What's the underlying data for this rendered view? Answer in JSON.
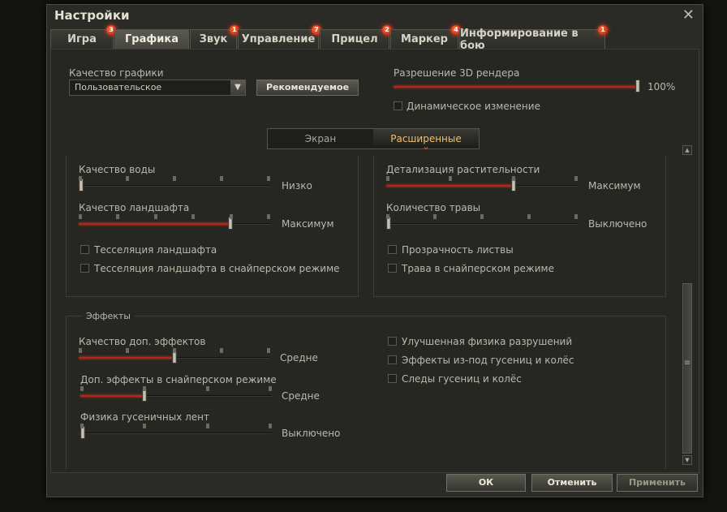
{
  "window": {
    "title": "Настройки"
  },
  "tabs": [
    {
      "label": "Игра",
      "badge": "3"
    },
    {
      "label": "Графика",
      "badge": ""
    },
    {
      "label": "Звук",
      "badge": "1"
    },
    {
      "label": "Управление",
      "badge": "7"
    },
    {
      "label": "Прицел",
      "badge": "2"
    },
    {
      "label": "Маркер",
      "badge": "4"
    },
    {
      "label": "Информирование в бою",
      "badge": "1"
    }
  ],
  "graphics": {
    "quality_label": "Качество графики",
    "quality_value": "Пользовательское",
    "recommended_button": "Рекомендуемое",
    "resolution_label": "Разрешение 3D рендера",
    "resolution_value": "100%",
    "resolution_level": 1.0,
    "dynamic_label": "Динамическое изменение"
  },
  "subtabs": [
    "Экран",
    "Расширенные"
  ],
  "left_panel": {
    "water_label": "Качество воды",
    "water_value": "Низко",
    "water_level": 0,
    "landscape_label": "Качество ландшафта",
    "landscape_value": "Максимум",
    "landscape_level": 0.8,
    "tess_label": "Тесселяция ландшафта",
    "tess_sniper_label": "Тесселяция ландшафта в снайперском режиме"
  },
  "right_panel": {
    "veg_label": "Детализация растительности",
    "veg_value": "Максимум",
    "veg_level": 0.67,
    "grass_label": "Количество травы",
    "grass_value": "Выключено",
    "grass_level": 0,
    "foliage_label": "Прозрачность листвы",
    "grass_sniper_label": "Трава в снайперском режиме"
  },
  "effects": {
    "title": "Эффекты",
    "fx_label": "Качество доп. эффектов",
    "fx_value": "Средне",
    "fx_level": 0.5,
    "fx_sniper_label": "Доп. эффекты в снайперском режиме",
    "fx_sniper_value": "Средне",
    "fx_sniper_level": 0.33,
    "tracks_label": "Физика гусеничных лент",
    "tracks_value": "Выключено",
    "tracks_level": 0,
    "destruction_label": "Улучшенная физика разрушений",
    "track_fx_label": "Эффекты из-под гусениц и колёс",
    "track_marks_label": "Следы гусениц и колёс"
  },
  "footer": {
    "ok": "ОК",
    "cancel": "Отменить",
    "apply": "Применить"
  },
  "colors": {
    "accent": "#b0281a",
    "badge": "#d02810",
    "active_subtab": "#f0c070"
  },
  "icons": {
    "close": "close-icon",
    "dropdown": "chevron-down-icon"
  }
}
